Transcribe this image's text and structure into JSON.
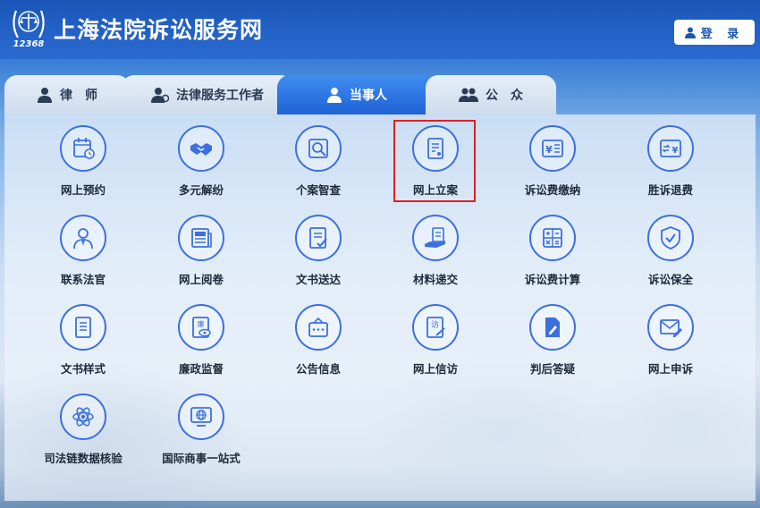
{
  "header": {
    "logo_text": "12368",
    "title": "上海法院诉讼服务网",
    "login_label": "登 录"
  },
  "tabs": [
    {
      "label": "律　师",
      "icon": "lawyer-icon",
      "active": false
    },
    {
      "label": "法律服务工作者",
      "icon": "legal-worker-icon",
      "active": false
    },
    {
      "label": "当事人",
      "icon": "party-icon",
      "active": true
    },
    {
      "label": "公　众",
      "icon": "public-icon",
      "active": false
    }
  ],
  "services": [
    {
      "label": "网上预约",
      "icon": "calendar-icon"
    },
    {
      "label": "多元解纷",
      "icon": "handshake-icon"
    },
    {
      "label": "个案智查",
      "icon": "search-doc-icon"
    },
    {
      "label": "网上立案",
      "icon": "file-case-icon",
      "highlighted": true
    },
    {
      "label": "诉讼费缴纳",
      "icon": "yuan-bill-icon"
    },
    {
      "label": "胜诉退费",
      "icon": "refund-icon"
    },
    {
      "label": "联系法官",
      "icon": "judge-icon"
    },
    {
      "label": "网上阅卷",
      "icon": "newspaper-icon"
    },
    {
      "label": "文书送达",
      "icon": "doc-check-icon"
    },
    {
      "label": "材料递交",
      "icon": "hand-doc-icon"
    },
    {
      "label": "诉讼费计算",
      "icon": "calculator-icon"
    },
    {
      "label": "诉讼保全",
      "icon": "shield-check-icon"
    },
    {
      "label": "文书样式",
      "icon": "document-list-icon"
    },
    {
      "label": "廉政监督",
      "icon": "integrity-eye-icon"
    },
    {
      "label": "公告信息",
      "icon": "announcement-icon"
    },
    {
      "label": "网上信访",
      "icon": "petition-icon"
    },
    {
      "label": "判后答疑",
      "icon": "doc-edit-icon"
    },
    {
      "label": "网上申诉",
      "icon": "mail-edit-icon"
    },
    {
      "label": "司法链数据核验",
      "icon": "atom-icon"
    },
    {
      "label": "国际商事一站式",
      "icon": "globe-screen-icon"
    }
  ],
  "colors": {
    "brand_blue": "#1a56b8",
    "icon_blue": "#3d6fe0",
    "highlight_red": "#e02020"
  }
}
